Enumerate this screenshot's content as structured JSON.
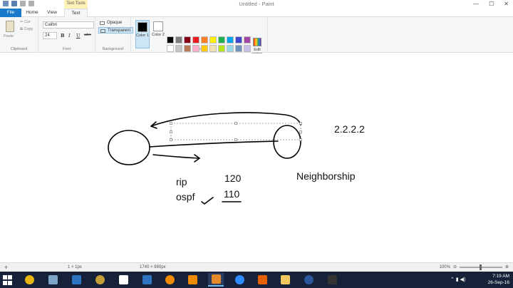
{
  "window": {
    "title": "Untitled - Paint",
    "contextual_group": "Text Tools",
    "controls": {
      "minimize": "—",
      "maximize": "☐",
      "close": "✕"
    }
  },
  "tabs": [
    {
      "label": "File"
    },
    {
      "label": "Home"
    },
    {
      "label": "View"
    },
    {
      "label": "Text"
    }
  ],
  "ribbon": {
    "clipboard": {
      "paste": "Paste",
      "cut": "Cut",
      "copy": "Copy",
      "group": "Clipboard"
    },
    "font": {
      "family": "Calibri",
      "size": "24",
      "bold": "B",
      "italic": "I",
      "underline": "U",
      "strike": "abc",
      "group": "Font"
    },
    "background": {
      "opaque": "Opaque",
      "transparent": "Transparent",
      "group": "Background"
    },
    "colors": {
      "color1_label": "Color 1",
      "color2_label": "Color 2",
      "color1": "#000000",
      "color2": "#ffffff",
      "edit_label": "Edit colors",
      "group": "Colors",
      "palette": [
        "#000000",
        "#7f7f7f",
        "#880015",
        "#ed1c24",
        "#ff7f27",
        "#fff200",
        "#22b14c",
        "#00a2e8",
        "#3f48cc",
        "#a349a4",
        "#ffffff",
        "#c3c3c3",
        "#b97a57",
        "#ffaec9",
        "#ffc90e",
        "#efe4b0",
        "#b5e61d",
        "#99d9ea",
        "#7092be",
        "#c8bfe7",
        "#ffffff",
        "#ffffff",
        "#ffffff",
        "#ffffff",
        "#ffffff",
        "#ffffff",
        "#ffffff",
        "#ffffff",
        "#ffffff",
        "#ffffff"
      ]
    }
  },
  "canvas": {
    "labels": {
      "ip": "2.2.2.2",
      "neighborship": "Neighborship",
      "rip": "rip",
      "ospf": "ospf",
      "rip_value": "120",
      "ospf_value": "110"
    }
  },
  "statusbar": {
    "selection": "1 × 1px",
    "size": "1740 × 980px",
    "zoom": "100%"
  },
  "taskbar": {
    "time": "7:19 AM",
    "date": "26-Sep-16",
    "apps": [
      {
        "name": "chrome",
        "color": "#e8b40f"
      },
      {
        "name": "network-tool",
        "color": "#7ea6c8"
      },
      {
        "name": "firefox-dev",
        "color": "#2f74c0"
      },
      {
        "name": "tool-app",
        "color": "#c59e39"
      },
      {
        "name": "idea-app",
        "color": "#ffffff"
      },
      {
        "name": "media-app",
        "color": "#2f74c0"
      },
      {
        "name": "vlc",
        "color": "#f08a00"
      },
      {
        "name": "vlc-2",
        "color": "#f08a00"
      },
      {
        "name": "paint",
        "color": "#e48a2b"
      },
      {
        "name": "zoom",
        "color": "#2d8cff"
      },
      {
        "name": "firefox",
        "color": "#e66000"
      },
      {
        "name": "folder",
        "color": "#f2c75c"
      },
      {
        "name": "word",
        "color": "#2b579a"
      },
      {
        "name": "terminal",
        "color": "#333333"
      }
    ]
  }
}
